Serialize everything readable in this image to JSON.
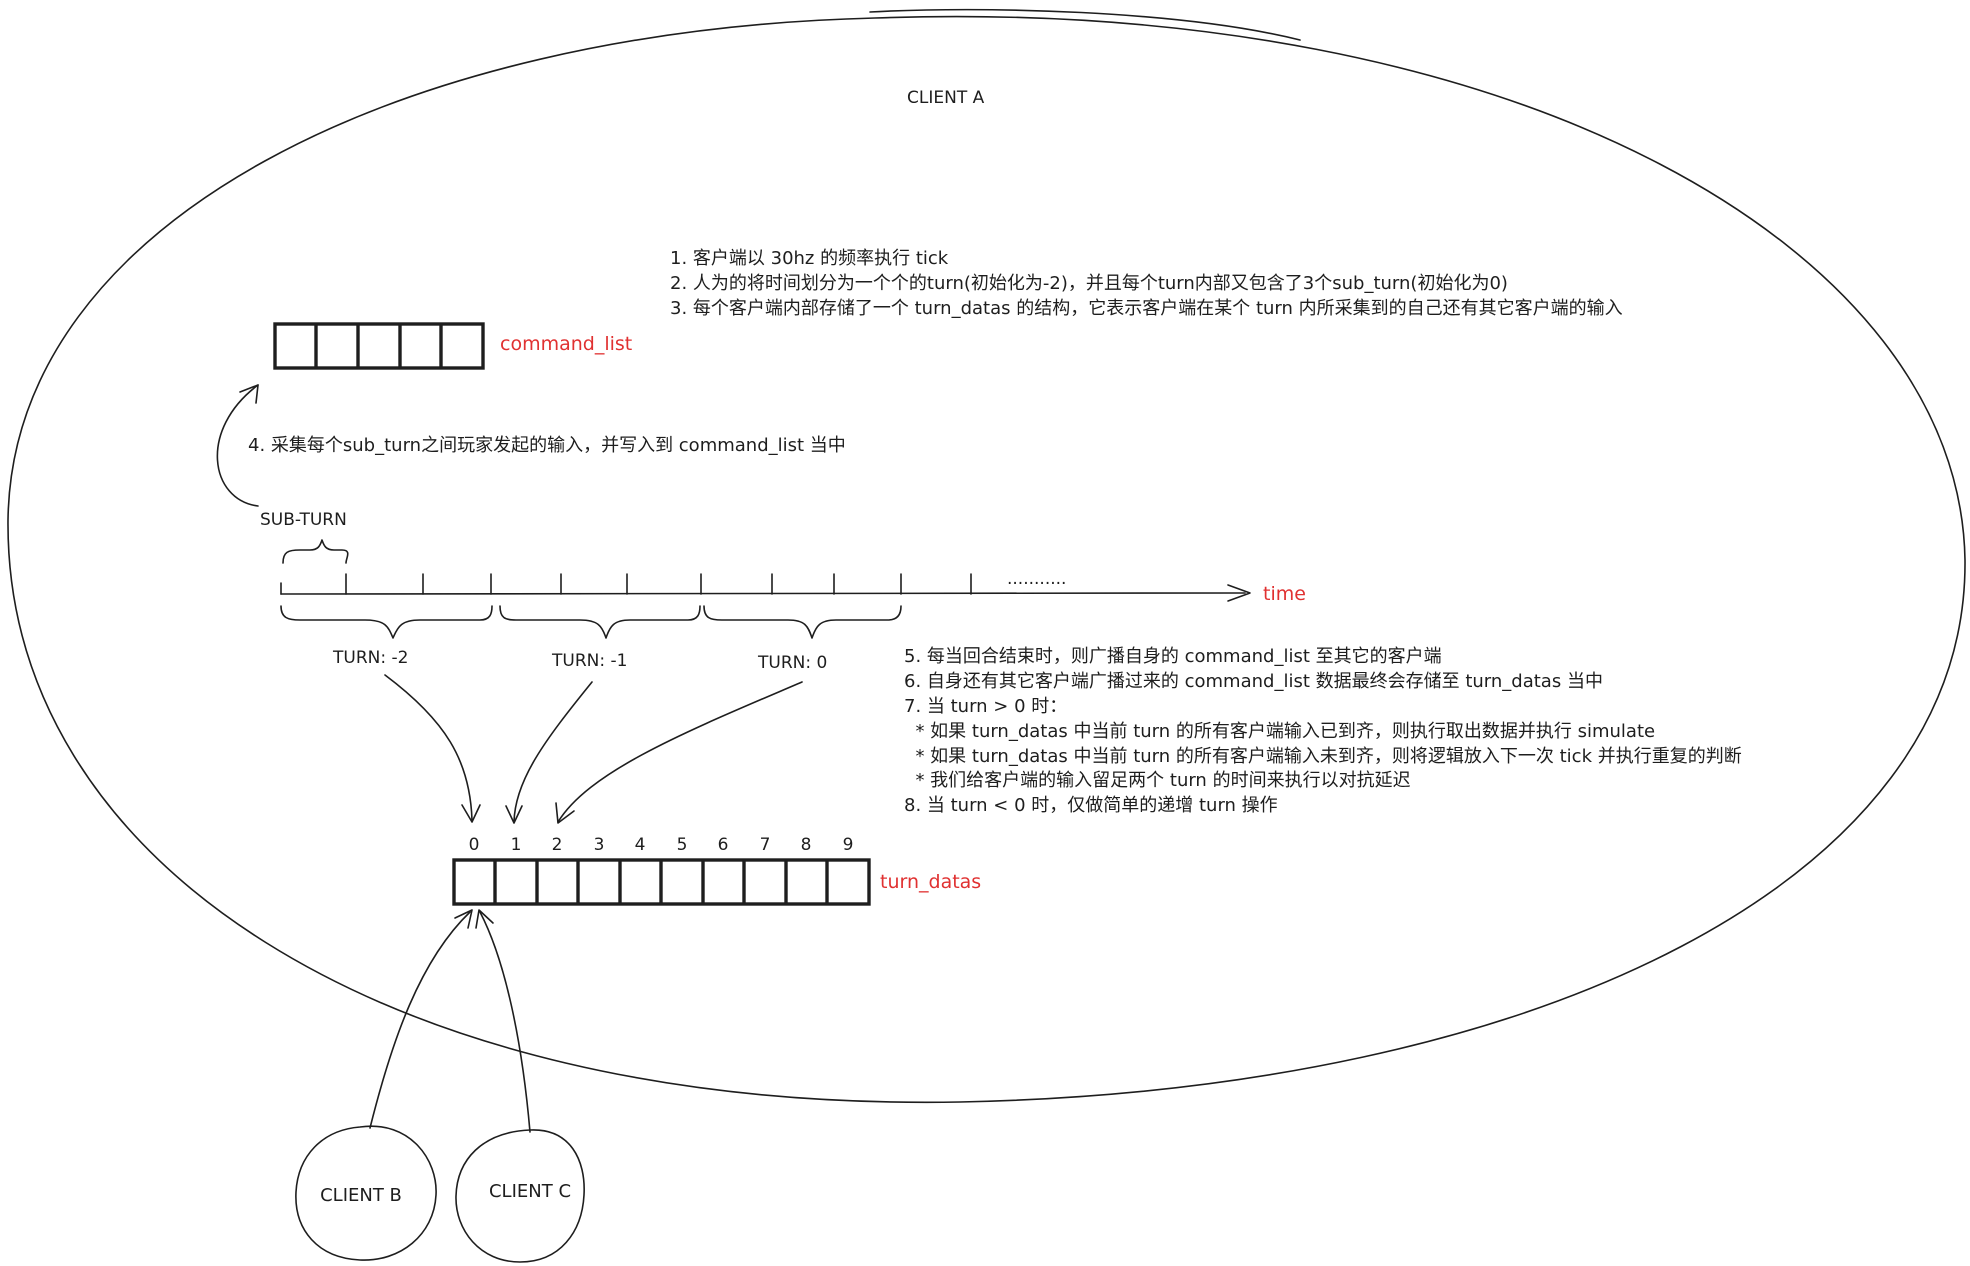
{
  "diagram": {
    "client_a_label": "CLIENT A",
    "notes_top": [
      "1.  客户端以 30hz 的频率执行 tick",
      "2. 人为的将时间划分为一个个的turn(初始化为-2)，并且每个turn内部又包含了3个sub_turn(初始化为0)",
      "3. 每个客户端内部存储了一个 turn_datas 的结构，它表示客户端在某个 turn 内所采集到的自己还有其它客户端的输入"
    ],
    "command_list_label": "command_list",
    "note_4": "4. 采集每个sub_turn之间玩家发起的输入，并写入到 command_list 当中",
    "sub_turn_label": "SUB-TURN",
    "time_label": "time",
    "ellipsis": "...........",
    "turn_labels": [
      "TURN: -2",
      "TURN: -1",
      "TURN: 0"
    ],
    "notes_bottom": [
      "5. 每当回合结束时，则广播自身的 command_list 至其它的客户端",
      "6. 自身还有其它客户端广播过来的 command_list 数据最终会存储至 turn_datas 当中",
      "7. 当 turn > 0 时：",
      "  * 如果 turn_datas 中当前 turn 的所有客户端输入已到齐，则执行取出数据并执行 simulate",
      "  * 如果 turn_datas 中当前 turn 的所有客户端输入未到齐，则将逻辑放入下一次 tick 并执行重复的判断",
      "  * 我们给客户端的输入留足两个 turn 的时间来执行以对抗延迟",
      "8. 当 turn < 0 时，仅做简单的递增 turn 操作"
    ],
    "turn_datas_indices": [
      "0",
      "1",
      "2",
      "3",
      "4",
      "5",
      "6",
      "7",
      "8",
      "9"
    ],
    "turn_datas_label": "turn_datas",
    "client_b_label": "CLIENT B",
    "client_c_label": "CLIENT C",
    "colors": {
      "stroke": "#1e1e1e",
      "accent_red": "#e03131"
    }
  }
}
